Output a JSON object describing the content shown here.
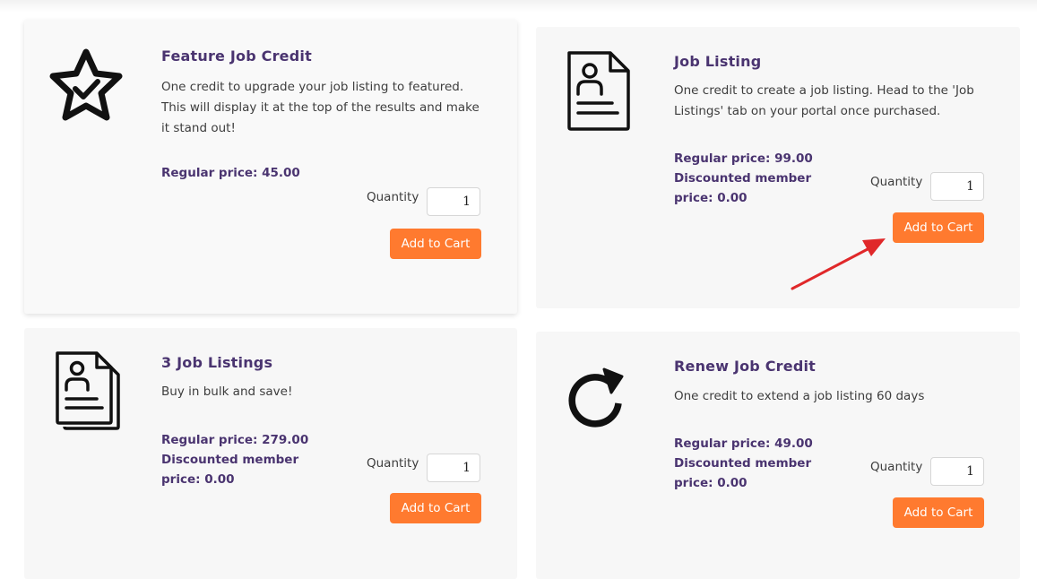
{
  "products": [
    {
      "title": "Feature Job Credit",
      "icon": "star-check-icon",
      "description": "One credit to upgrade your job listing to featured. This will display it at the top of the results and make it stand out!",
      "regular_price": "Regular price: 45.00",
      "member_price_line1": "",
      "member_price_line2": "",
      "quantity_label": "Quantity",
      "quantity": "1",
      "cart_label": "Add to Cart"
    },
    {
      "title": "Job Listing",
      "icon": "document-person-icon",
      "description": "One credit to create a job listing. Head to the 'Job Listings' tab on your portal once purchased.",
      "regular_price": "Regular price: 99.00",
      "member_price_line1": "Discounted member",
      "member_price_line2": "price: 0.00",
      "quantity_label": "Quantity",
      "quantity": "1",
      "cart_label": "Add to Cart"
    },
    {
      "title": "3 Job Listings",
      "icon": "documents-stack-icon",
      "description": "Buy in bulk and save!",
      "regular_price": "Regular price: 279.00",
      "member_price_line1": "Discounted member",
      "member_price_line2": "price: 0.00",
      "quantity_label": "Quantity",
      "quantity": "1",
      "cart_label": "Add to Cart"
    },
    {
      "title": "Renew Job Credit",
      "icon": "renew-arrow-icon",
      "description": "One credit to extend a job listing 60 days",
      "regular_price": "Regular price: 49.00",
      "member_price_line1": "Discounted member",
      "member_price_line2": "price: 0.00",
      "quantity_label": "Quantity",
      "quantity": "1",
      "cart_label": "Add to Cart"
    }
  ],
  "annotation": {
    "icon": "red-pointer-arrow",
    "color": "#e0282a"
  },
  "colors": {
    "accent": "#ff7a2f",
    "title": "#4a3470"
  }
}
